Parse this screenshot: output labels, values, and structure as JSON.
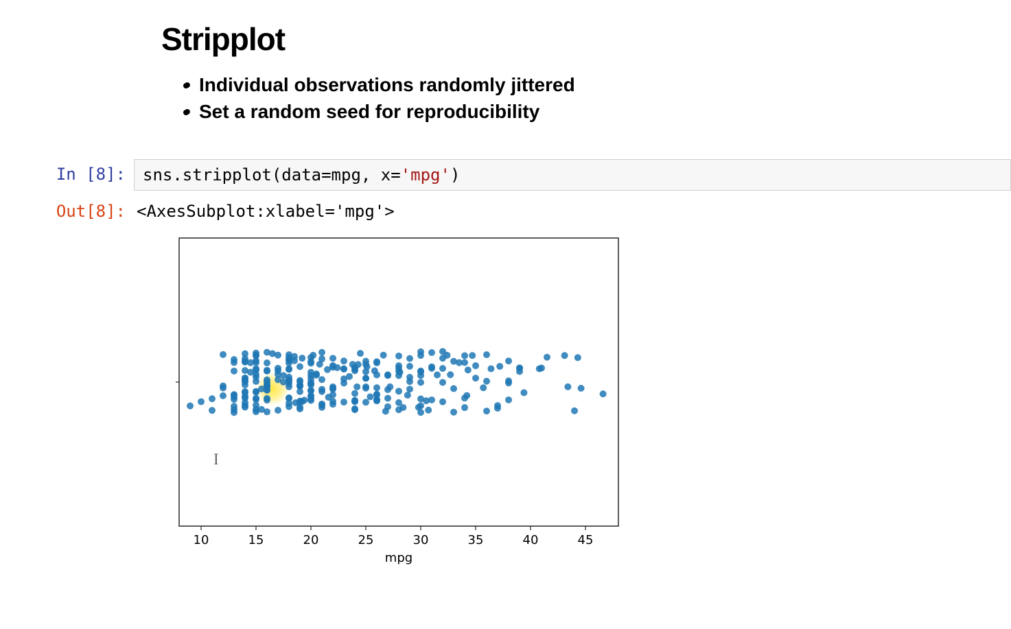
{
  "title": "Stripplot",
  "bullets": [
    "Individual observations randomly jittered",
    "Set a random seed for reproducibility"
  ],
  "cell": {
    "in_prompt": "In [8]:",
    "out_prompt": "Out[8]:",
    "code_prefix": "sns.stripplot(data",
    "code_eq1": "=",
    "code_arg1": "mpg, x",
    "code_eq2": "=",
    "code_str": "'mpg'",
    "code_suffix": ")",
    "output_text": "<AxesSubplot:xlabel='mpg'>"
  },
  "chart_data": {
    "type": "scatter",
    "title": "",
    "xlabel": "mpg",
    "ylabel": "",
    "xlim": [
      8,
      48
    ],
    "ylim": [
      -0.5,
      0.5
    ],
    "xticks": [
      10,
      15,
      20,
      25,
      30,
      35,
      40,
      45
    ],
    "jitter_range": 0.4,
    "point_color": "#1f77b4",
    "highlight_center_x": 16.5,
    "x": [
      9,
      10,
      11,
      11,
      12,
      12,
      12,
      12,
      13,
      13,
      13,
      13,
      13,
      13,
      13,
      13,
      13,
      13,
      14,
      14,
      14,
      14,
      14,
      14,
      14,
      14,
      14,
      14,
      14,
      14,
      14,
      14,
      14,
      14,
      14,
      14.5,
      14.5,
      15,
      15,
      15,
      15,
      15,
      15,
      15,
      15,
      15,
      15,
      15,
      15,
      15,
      15,
      15,
      15,
      15,
      15.5,
      15.5,
      16,
      16,
      16,
      16,
      16,
      16,
      16,
      16,
      16,
      16,
      16,
      16,
      16,
      16,
      16,
      16.5,
      17,
      17,
      17,
      17,
      17,
      17,
      17.5,
      17.5,
      18,
      18,
      18,
      18,
      18,
      18,
      18,
      18,
      18,
      18,
      18,
      18,
      18,
      18,
      18,
      18,
      18,
      18.5,
      18.5,
      18.6,
      19,
      19,
      19,
      19,
      19,
      19,
      19,
      19,
      19,
      19,
      19,
      19,
      19.2,
      19.2,
      19.4,
      20,
      20,
      20,
      20,
      20,
      20,
      20,
      20,
      20,
      20,
      20,
      20,
      20,
      20,
      20,
      20.2,
      20.5,
      20.5,
      20.8,
      21,
      21,
      21,
      21,
      21,
      21,
      21,
      21,
      21.5,
      21.6,
      22,
      22,
      22,
      22,
      22,
      22,
      22,
      22,
      22,
      22.4,
      23,
      23,
      23,
      23,
      23,
      23,
      23.5,
      23.8,
      24,
      24,
      24,
      24,
      24,
      24,
      24,
      24,
      24,
      24.2,
      24.3,
      24.5,
      25,
      25,
      25,
      25,
      25,
      25,
      25,
      25,
      25.1,
      25.4,
      25.8,
      26,
      26,
      26,
      26,
      26,
      26,
      26,
      26,
      26,
      26.6,
      26.8,
      27,
      27,
      27,
      27,
      27,
      27.2,
      28,
      28,
      28,
      28,
      28,
      28,
      28,
      28,
      28.1,
      28.4,
      28.8,
      29,
      29,
      29,
      29,
      29,
      29.8,
      30,
      30,
      30,
      30,
      30,
      30,
      30,
      30,
      30,
      30.5,
      30.7,
      31,
      31,
      31,
      31,
      31.5,
      32,
      32,
      32,
      32,
      32,
      32.4,
      32.7,
      33,
      33,
      33,
      33.5,
      34,
      34,
      34,
      34,
      34.2,
      34.3,
      34.7,
      35,
      35,
      35.7,
      36,
      36,
      36,
      36.4,
      37,
      37,
      37.2,
      38,
      38,
      38,
      38,
      39,
      39,
      39,
      39.4,
      40.8,
      41,
      41.5,
      43.1,
      43.4,
      44,
      44.3,
      44.6,
      46.6
    ]
  }
}
